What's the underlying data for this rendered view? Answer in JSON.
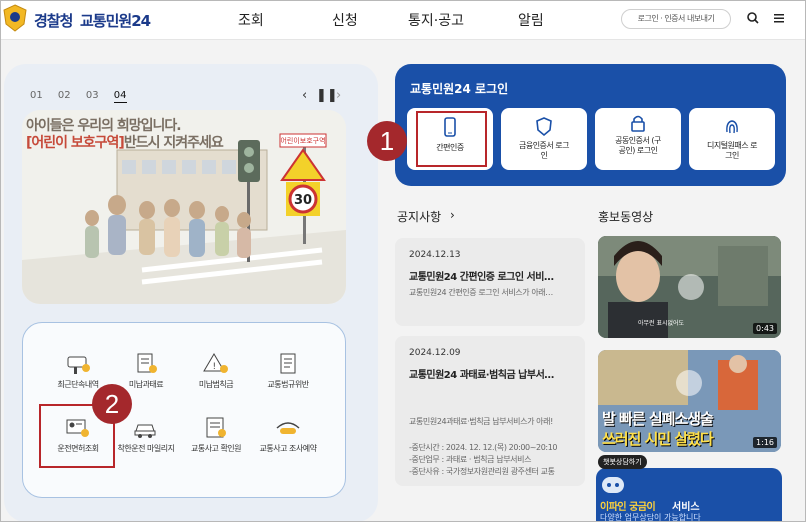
{
  "header": {
    "logo_agency": "경찰청",
    "logo_service": "교통민원24",
    "nav": [
      "조회",
      "신청",
      "통지·공고",
      "알림"
    ],
    "login_pill": "로그인 · 인증서 내보내기"
  },
  "slider": {
    "pages": [
      "01",
      "02",
      "03",
      "04"
    ],
    "active": "04",
    "banner_line1": "아이들은 우리의 희망입니다.",
    "banner_line2_red": "[어린이 보호구역]",
    "banner_line2_rest": "반드시 지켜주세요",
    "sign_text": "어린이보호구역",
    "speed_limit": "30"
  },
  "quick_menu": [
    {
      "label": "최근단속내역"
    },
    {
      "label": "미납과태료"
    },
    {
      "label": "미납범칙금"
    },
    {
      "label": "교통법규위반"
    },
    {
      "label": "운전면허조회"
    },
    {
      "label": "착한운전 마일리지"
    },
    {
      "label": "교통사고 확인원"
    },
    {
      "label": "교통사고 조사예약"
    }
  ],
  "login": {
    "title": "교통민원24 로그인",
    "buttons": [
      {
        "label": "간편인증"
      },
      {
        "label": "금융인증서 로그인"
      },
      {
        "label": "공동인증서 (구 공인) 로그인"
      },
      {
        "label": "디지털원패스 로그인"
      }
    ]
  },
  "notices": {
    "title": "공지사항",
    "items": [
      {
        "date": "2024.12.13",
        "title": "교통민원24 간편인증 로그인 서비…",
        "desc": "교통민원24 간편인증 로그인 서비스가 아래…"
      },
      {
        "date": "2024.12.09",
        "title": "교통민원24 과태료·범칙금 납부서…",
        "desc": "교통민원24과태료·범칙금 납부서비스가 아래!",
        "lines": [
          "-중단시간 : 2024. 12. 12.(목) 20:00~20:10",
          "-중단업무 : 과태료 · 범칙금 납부서비스",
          "-중단사유 : 국가정보자원관리원 광주센터 교통"
        ]
      }
    ]
  },
  "videos": {
    "title": "홍보동영상",
    "items": [
      {
        "duration": "0:43",
        "caption": "아무런 표시없어도"
      },
      {
        "duration": "1:16",
        "caption_line1": "발 빠른 실폐소생술",
        "caption_line2": "쓰러진 시민 살렸다"
      }
    ]
  },
  "chatbot": {
    "tooltip": "챗봇상담하기",
    "title_highlight": "이파인 궁금이",
    "title_rest": "서비스",
    "subtitle": "다양한 업무상담이 가능합니다"
  },
  "callouts": [
    "1",
    "2"
  ],
  "colors": {
    "brand": "#1a50a8",
    "callout": "#a4282c"
  }
}
